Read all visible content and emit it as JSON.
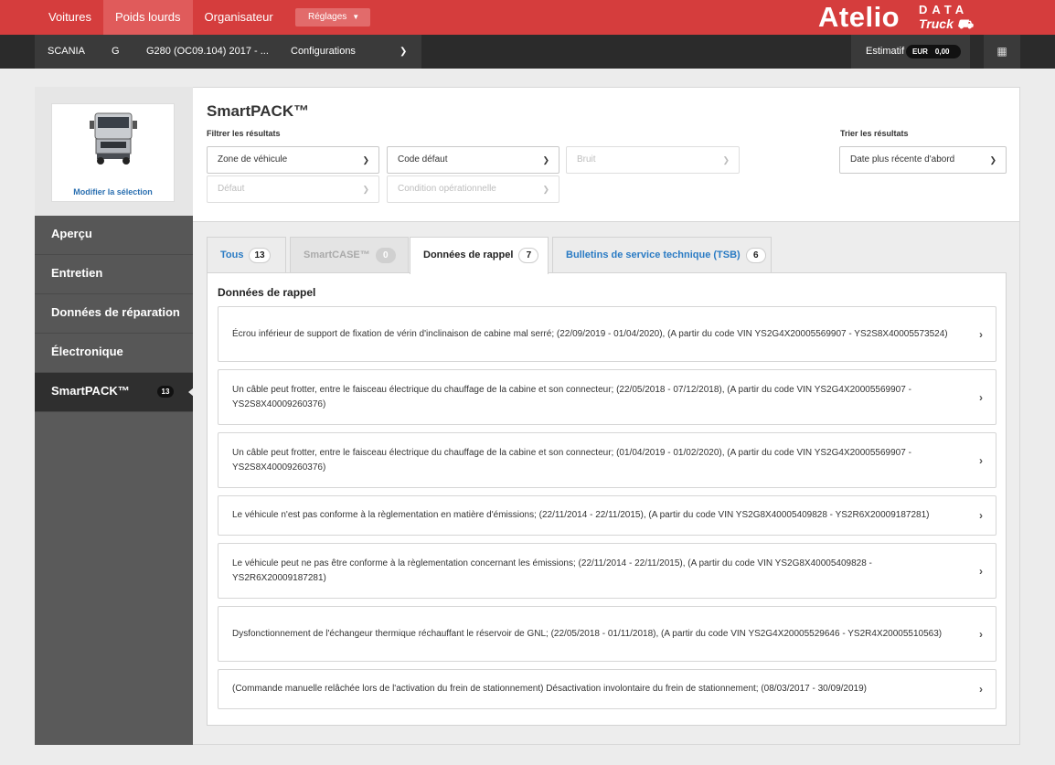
{
  "topnav": {
    "items": [
      {
        "label": "Voitures"
      },
      {
        "label": "Poids lourds"
      },
      {
        "label": "Organisateur"
      }
    ],
    "settings_label": "Réglages"
  },
  "logo": {
    "main": "Atelio",
    "data": "DATA",
    "truck": "Truck"
  },
  "vehicle": {
    "brand": "SCANIA",
    "series": "G",
    "model": "G280 (OC09.104) 2017 - ...",
    "config_label": "Configurations",
    "estimatif_label": "Estimatif",
    "currency": "EUR",
    "amount": "0,00"
  },
  "sidebar": {
    "modify_label": "Modifier la sélection",
    "items": [
      {
        "label": "Aperçu"
      },
      {
        "label": "Entretien"
      },
      {
        "label": "Données de réparation"
      },
      {
        "label": "Électronique"
      },
      {
        "label": "SmartPACK™",
        "badge": "13"
      }
    ]
  },
  "main": {
    "title": "SmartPACK™",
    "filter_label": "Filtrer les résultats",
    "sort_label": "Trier les résultats",
    "filters": {
      "zone": "Zone de véhicule",
      "code": "Code défaut",
      "bruit": "Bruit",
      "defaut": "Défaut",
      "condition": "Condition opérationnelle"
    },
    "sort_value": "Date plus récente d'abord",
    "tabs": [
      {
        "label": "Tous",
        "count": "13"
      },
      {
        "label": "SmartCASE™",
        "count": "0"
      },
      {
        "label": "Données de rappel",
        "count": "7"
      },
      {
        "label": "Bulletins de service technique (TSB)",
        "count": "6"
      }
    ],
    "content_title": "Données de rappel",
    "recalls": [
      {
        "text": "Écrou inférieur de support de fixation de vérin d'inclinaison de cabine mal serré; (22/09/2019 - 01/04/2020), (A partir du code VIN YS2G4X20005569907 - YS2S8X40005573524)"
      },
      {
        "text": "Un câble peut frotter, entre le faisceau électrique du chauffage de la cabine et son connecteur; (22/05/2018 - 07/12/2018), (A partir du code VIN YS2G4X20005569907 - YS2S8X40009260376)"
      },
      {
        "text": "Un câble peut frotter, entre le faisceau électrique du chauffage de la cabine et son connecteur; (01/04/2019 - 01/02/2020), (A partir du code VIN YS2G4X20005569907 - YS2S8X40009260376)"
      },
      {
        "text": "Le véhicule n'est pas conforme à la règlementation en matière d'émissions; (22/11/2014 - 22/11/2015), (A partir du code VIN YS2G8X40005409828 - YS2R6X20009187281)"
      },
      {
        "text": "Le véhicule peut ne pas être conforme à la règlementation concernant les émissions; (22/11/2014 - 22/11/2015), (A partir du code VIN YS2G8X40005409828 - YS2R6X20009187281)"
      },
      {
        "text": "Dysfonctionnement de l'échangeur thermique réchauffant le réservoir de GNL; (22/05/2018 - 01/11/2018), (A partir du code VIN YS2G4X20005529646 - YS2R4X20005510563)"
      },
      {
        "text": "(Commande manuelle relâchée lors de l'activation du frein de stationnement) Désactivation involontaire du frein de stationnement; (08/03/2017 - 30/09/2019)"
      }
    ]
  },
  "colors": {
    "brand_red": "#d53d3d",
    "dark_bar": "#2b2b2b",
    "link_blue": "#2a7bc4"
  }
}
